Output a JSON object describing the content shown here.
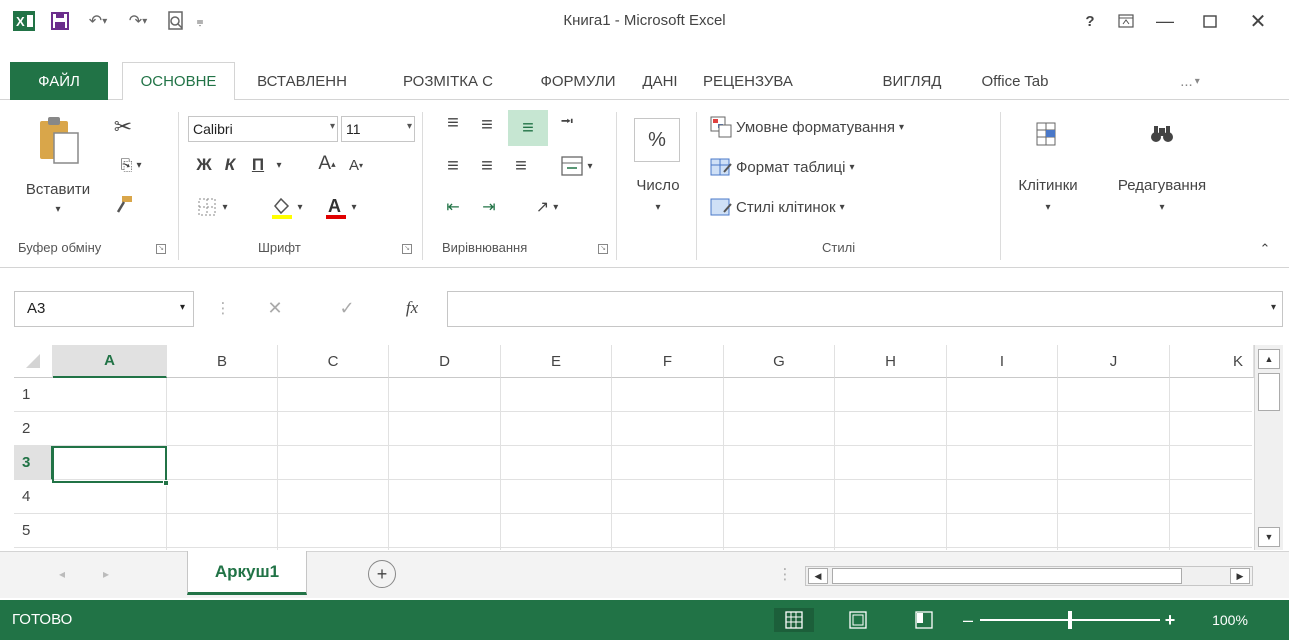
{
  "window": {
    "title": "Книга1 - Microsoft Excel",
    "help": "?",
    "icons": [
      "excel-logo-icon",
      "save-icon",
      "undo-icon",
      "redo-icon",
      "print-preview-icon",
      "customize-icon",
      "ribbon-display-icon",
      "minimize-icon",
      "maximize-icon",
      "close-icon"
    ]
  },
  "tabs": {
    "file": "ФАЙЛ",
    "items": [
      "ОСНОВНЕ",
      "ВСТАВЛЕНН",
      "РОЗМІТКА С",
      "ФОРМУЛИ",
      "ДАНІ",
      "РЕЦЕНЗУВА",
      "ВИГЛЯД",
      "Office Tab"
    ],
    "more": "...",
    "active": "ОСНОВНЕ"
  },
  "ribbon": {
    "clipboard": {
      "paste_label": "Вставити",
      "group_label": "Буфер обміну"
    },
    "font": {
      "name": "Calibri",
      "size": "11",
      "bold": "Ж",
      "italic": "К",
      "underline": "П",
      "grow": "A",
      "shrink": "A",
      "group_label": "Шрифт"
    },
    "alignment": {
      "group_label": "Вирівнювання"
    },
    "number": {
      "symbol": "%",
      "label": "Число"
    },
    "styles": {
      "conditional": "Умовне форматування",
      "table": "Формат таблиці",
      "cell": "Стилі клітинок",
      "group_label": "Стилі"
    },
    "cells": {
      "label": "Клітинки"
    },
    "editing": {
      "label": "Редагування"
    }
  },
  "formula_bar": {
    "name_box": "A3",
    "fx": "fx",
    "value": ""
  },
  "grid": {
    "columns": [
      "A",
      "B",
      "C",
      "D",
      "E",
      "F",
      "G",
      "H",
      "I",
      "J",
      "K"
    ],
    "rows": [
      "1",
      "2",
      "3",
      "4",
      "5"
    ],
    "selected_cell": "A3"
  },
  "sheets": {
    "items": [
      "Аркуш1"
    ],
    "active": "Аркуш1"
  },
  "status": {
    "ready": "ГОТОВО",
    "zoom": "100%",
    "zoom_level": 1.0
  }
}
